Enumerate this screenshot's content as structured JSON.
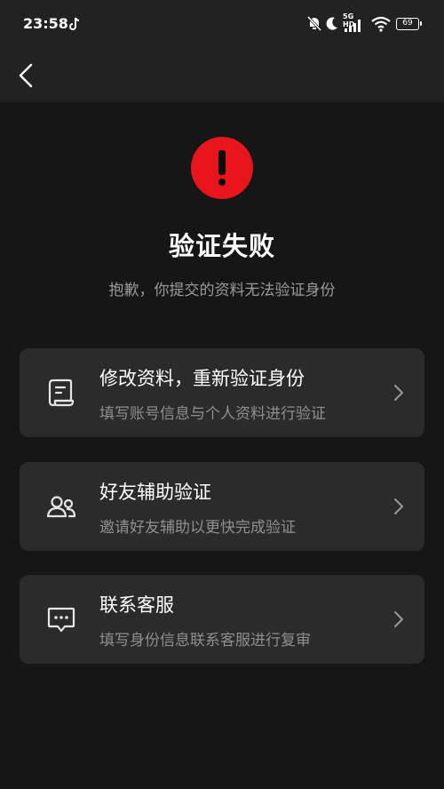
{
  "status_bar": {
    "time": "23:58",
    "network": "5G HD",
    "battery": "69"
  },
  "nav": {
    "back_icon": "chevron-left-icon"
  },
  "result": {
    "icon": "error-exclamation-icon",
    "icon_color": "#e8161c",
    "title": "验证失败",
    "subtitle": "抱歉，你提交的资料无法验证身份"
  },
  "options": [
    {
      "icon": "document-edit-icon",
      "title": "修改资料，重新验证身份",
      "desc": "填写账号信息与个人资料进行验证"
    },
    {
      "icon": "friends-icon",
      "title": "好友辅助验证",
      "desc": "邀请好友辅助以更快完成验证"
    },
    {
      "icon": "chat-bubble-icon",
      "title": "联系客服",
      "desc": "填写身份信息联系客服进行复审"
    }
  ]
}
